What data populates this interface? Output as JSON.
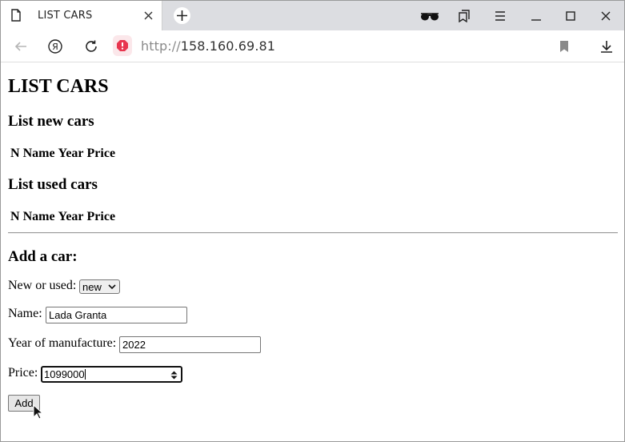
{
  "browser": {
    "tab_title": "LIST CARS",
    "url_protocol": "http://",
    "url_host": "158.160.69.81"
  },
  "page": {
    "title": "LIST CARS",
    "new_section_title": "List new cars",
    "used_section_title": "List used cars",
    "table_columns": [
      "N",
      "Name",
      "Year",
      "Price"
    ],
    "form": {
      "title": "Add a car:",
      "type_label": "New or used:",
      "type_selected": "new",
      "name_label": "Name:",
      "name_value": "Lada Granta",
      "year_label": "Year of manufacture:",
      "year_value": "2022",
      "price_label": "Price:",
      "price_value": "1099000",
      "submit_label": "Add"
    }
  },
  "colors": {
    "tabbar_bg": "#dcdde1",
    "security_warning": "#e8364f"
  },
  "icons": {
    "tab": "page-icon",
    "toolbar": [
      "reader-mode-icon",
      "collections-icon",
      "menu-icon",
      "minimize-icon",
      "maximize-icon",
      "close-window-icon"
    ],
    "nav": [
      "back-icon",
      "yandex-icon",
      "reload-icon",
      "security-warning-icon",
      "bookmark-icon",
      "download-icon"
    ]
  }
}
